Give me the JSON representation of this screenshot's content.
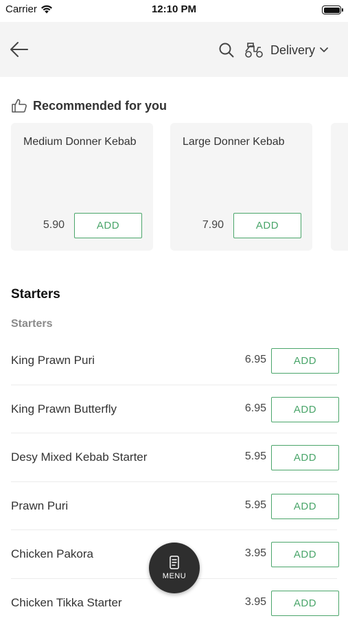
{
  "status_bar": {
    "carrier": "Carrier",
    "time": "12:10 PM"
  },
  "header": {
    "delivery_label": "Delivery"
  },
  "recommended": {
    "title": "Recommended for you",
    "items": [
      {
        "name": "Medium Donner Kebab",
        "price": "5.90",
        "add_label": "ADD"
      },
      {
        "name": "Large Donner Kebab",
        "price": "7.90",
        "add_label": "ADD"
      }
    ]
  },
  "section": {
    "title": "Starters",
    "subtitle": "Starters"
  },
  "items": [
    {
      "name": "King Prawn Puri",
      "price": "6.95",
      "add_label": "ADD"
    },
    {
      "name": "King Prawn Butterfly",
      "price": "6.95",
      "add_label": "ADD"
    },
    {
      "name": "Desy Mixed Kebab Starter",
      "price": "5.95",
      "add_label": "ADD"
    },
    {
      "name": "Prawn Puri",
      "price": "5.95",
      "add_label": "ADD"
    },
    {
      "name": "Chicken Pakora",
      "price": "3.95",
      "add_label": "ADD"
    },
    {
      "name": "Chicken Tikka Starter",
      "price": "3.95",
      "add_label": "ADD"
    }
  ],
  "menu_button": {
    "label": "MENU"
  },
  "colors": {
    "accent": "#4aa56a",
    "header_bg": "#f4f4f4",
    "card_bg": "#f5f5f5",
    "fab_bg": "#2e2e2e"
  }
}
